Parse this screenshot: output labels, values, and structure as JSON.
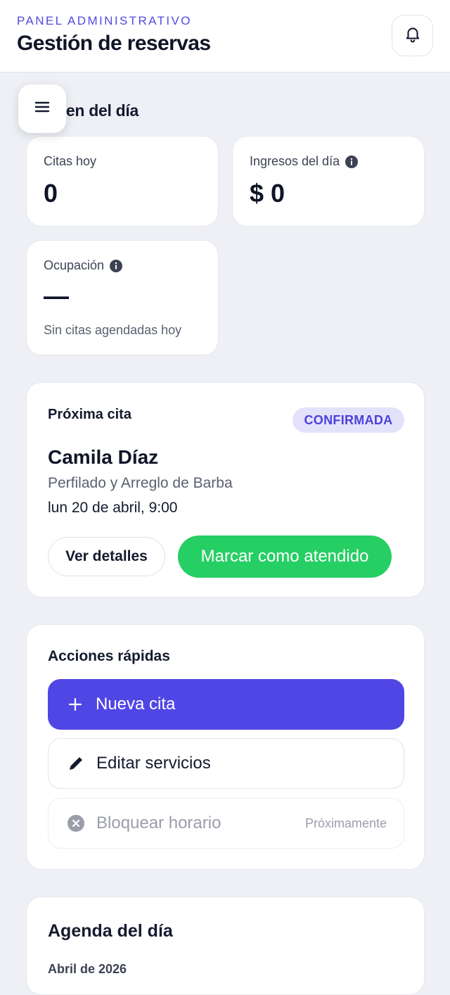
{
  "header": {
    "eyebrow": "PANEL ADMINISTRATIVO",
    "title": "Gestión de reservas",
    "notification_icon": "bell-icon"
  },
  "menu": {
    "icon": "menu-icon"
  },
  "summary": {
    "title": "umen del día",
    "stats": [
      {
        "label": "Citas hoy",
        "value": "0",
        "info": false
      },
      {
        "label": "Ingresos del día",
        "value": "$ 0",
        "info": true
      },
      {
        "label": "Ocupación",
        "value": "—",
        "info": true,
        "sub": "Sin citas agendadas hoy"
      }
    ]
  },
  "next_appointment": {
    "label": "Próxima cita",
    "status": "CONFIRMADA",
    "client": "Camila Díaz",
    "service": "Perfilado y Arreglo de Barba",
    "datetime": "lun 20 de abril, 9:00",
    "details_button": "Ver detalles",
    "attend_button": "Marcar como atendido"
  },
  "quick_actions": {
    "title": "Acciones rápidas",
    "new_appointment": "Nueva cita",
    "edit_services": "Editar servicios",
    "block_schedule": "Bloquear horario",
    "coming_soon": "Próximamente"
  },
  "agenda": {
    "title": "Agenda del día",
    "month": "Abril de 2026"
  },
  "colors": {
    "accent": "#5046e5",
    "success": "#26cf64",
    "badge_bg": "#e4e2fb"
  }
}
